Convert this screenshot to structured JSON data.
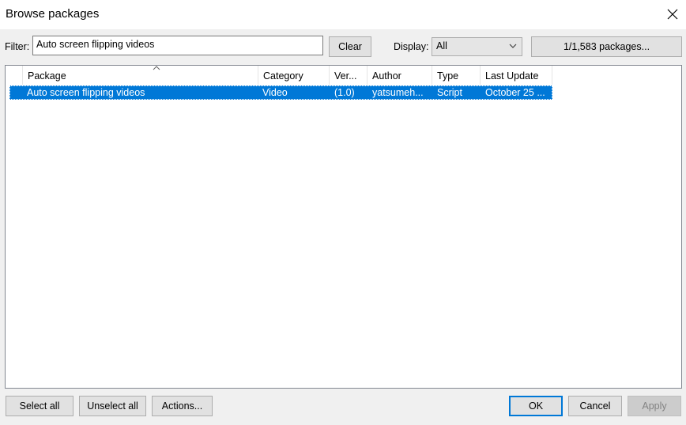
{
  "window": {
    "title": "Browse packages",
    "close_icon": "close-icon"
  },
  "filter": {
    "label": "Filter:",
    "value": "Auto screen flipping videos",
    "clear_label": "Clear"
  },
  "display": {
    "label": "Display:",
    "selected": "All"
  },
  "packages_count_label": "1/1,583 packages...",
  "table": {
    "columns": [
      "Package",
      "Category",
      "Ver...",
      "Author",
      "Type",
      "Last Update"
    ],
    "sorted_column": "Package",
    "rows": [
      {
        "package": "Auto screen flipping videos",
        "category": "Video",
        "version": "(1.0)",
        "author": "yatsumeh...",
        "type": "Script",
        "last_update": "October 25 ...",
        "selected": true
      }
    ]
  },
  "footer": {
    "select_all": "Select all",
    "unselect_all": "Unselect all",
    "actions": "Actions...",
    "ok": "OK",
    "cancel": "Cancel",
    "apply": "Apply"
  },
  "colors": {
    "selection": "#0078d7",
    "background": "#f0f0f0",
    "accent": "#0078d7"
  }
}
